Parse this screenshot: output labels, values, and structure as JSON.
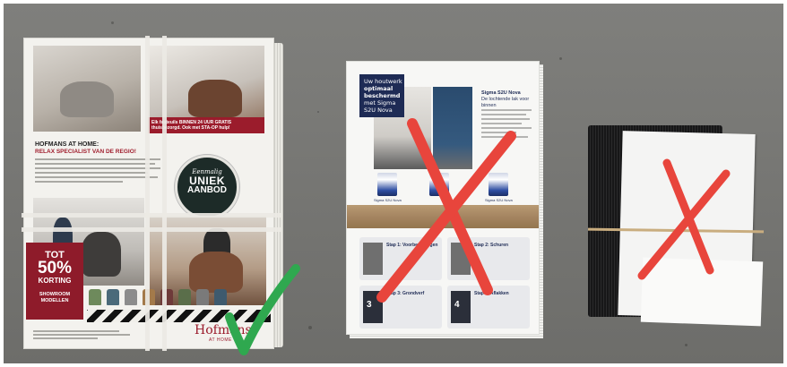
{
  "furniture_folder": {
    "sale_banner": "Elk fauteuils BINNEN 24 UUR GRATIS thuisbezorgd. Ook met STA-OP hulp!",
    "headline": "HOFMANS AT HOME:",
    "subheadline": "RELAX SPECIALIST VAN DE REGIO!",
    "badge_line1": "Eenmalig",
    "badge_line2": "UNIEK",
    "badge_line3": "AANBOD",
    "promo_line1": "TOT",
    "promo_line2": "50%",
    "promo_line3": "KORTING",
    "promo_line4": "SHOWROOM",
    "promo_line5": "MODELLEN",
    "logo": "Hofmans",
    "logo_sub": "AT HOME",
    "chair_colors": [
      "#6e8a5c",
      "#4b6a7a",
      "#8c8c8c",
      "#a37a4a",
      "#6e3a3a",
      "#5a6e4a",
      "#7a7a7a",
      "#3e5a6e"
    ]
  },
  "paint_folder": {
    "tag_line1": "Uw houtwerk",
    "tag_line2": "optimaal",
    "tag_line3": "beschermd",
    "tag_line4": "met Sigma",
    "tag_line5": "S2U Nova",
    "side_heading": "Sigma S2U Nova",
    "side_sub": "De lochtende lak voor binnen",
    "can_caption": "Sigma S2U Nova",
    "step1": "Stap 1: Voorbereidingen",
    "step2": "Stap 2: Schuren",
    "step3": "Stap 3: Grondverf",
    "step4": "Stap 4: Aflakken",
    "step3_num": "3",
    "step4_num": "4"
  },
  "marks": {
    "approved": "check-mark",
    "rejected": "x-mark",
    "check_color": "#2fa84f",
    "cross_color": "#e8453c"
  }
}
